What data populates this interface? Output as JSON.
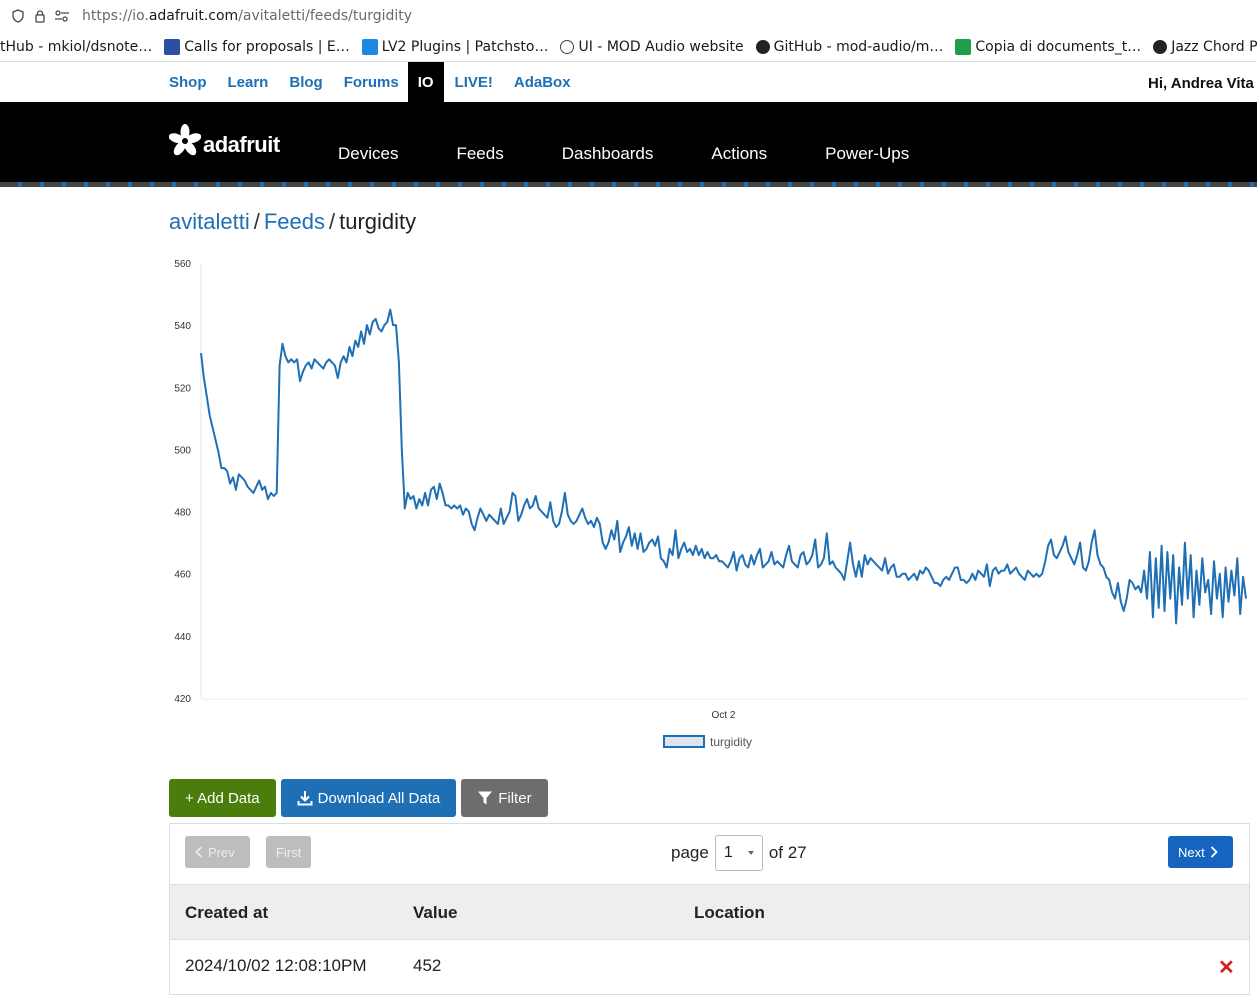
{
  "browser": {
    "url_prefix": "https://io.",
    "url_domain": "adafruit.com",
    "url_path": "/avitaletti/feeds/turgidity",
    "bookmarks": [
      {
        "label": "tHub - mkiol/dsnote…",
        "icon": "none"
      },
      {
        "label": "Calls for proposals | E…",
        "icon": "eu-icon"
      },
      {
        "label": "LV2 Plugins | Patchsto…",
        "icon": "patchstorage-icon"
      },
      {
        "label": "UI - MOD Audio website",
        "icon": "globe-icon"
      },
      {
        "label": "GitHub - mod-audio/m…",
        "icon": "github-icon"
      },
      {
        "label": "Copia di documents_t…",
        "icon": "sheets-icon"
      },
      {
        "label": "Jazz Chord Progre",
        "icon": "jazz-icon"
      }
    ]
  },
  "topnav": {
    "links": [
      "Shop",
      "Learn",
      "Blog",
      "Forums",
      "IO",
      "LIVE!",
      "AdaBox"
    ],
    "active": "IO",
    "greeting": "Hi, Andrea Vita"
  },
  "header": {
    "logo_text": "adafruit",
    "nav": [
      "Devices",
      "Feeds",
      "Dashboards",
      "Actions",
      "Power-Ups"
    ]
  },
  "breadcrumb": {
    "user": "avitaletti",
    "section": "Feeds",
    "current": "turgidity",
    "sep": "/"
  },
  "chart_data": {
    "type": "line",
    "title": "",
    "xlabel": "",
    "ylabel": "",
    "ylim": [
      420,
      560
    ],
    "yticks": [
      420,
      440,
      460,
      480,
      500,
      520,
      540,
      560
    ],
    "xticks": [
      {
        "label": "Oct 2",
        "frac": 0.5
      }
    ],
    "legend": {
      "label": "turgidity",
      "position": "bottom"
    },
    "grid": false,
    "colors": {
      "line": "#1f6fb5",
      "legend_fill": "#dde6f0"
    },
    "series": [
      {
        "name": "turgidity",
        "values": [
          531,
          523,
          517,
          511,
          507,
          503,
          499,
          494,
          494,
          493,
          489,
          491,
          487,
          492,
          491,
          490,
          488,
          487,
          486,
          488,
          490,
          487,
          488,
          484,
          486,
          485,
          486,
          527,
          534,
          530,
          528,
          529,
          528,
          529,
          522,
          525,
          527,
          528,
          526,
          529,
          528,
          527,
          526,
          528,
          529,
          528,
          527,
          523,
          528,
          530,
          528,
          533,
          530,
          535,
          533,
          538,
          534,
          540,
          537,
          541,
          542,
          539,
          538,
          540,
          541,
          545,
          540,
          540,
          528,
          500,
          481,
          486,
          484,
          485,
          481,
          484,
          482,
          486,
          482,
          487,
          488,
          484,
          489,
          486,
          482,
          482,
          481,
          482,
          481,
          482,
          479,
          481,
          480,
          476,
          474,
          478,
          481,
          479,
          477,
          479,
          478,
          477,
          476,
          481,
          476,
          478,
          480,
          486,
          485,
          477,
          479,
          482,
          484,
          481,
          482,
          485,
          481,
          480,
          479,
          478,
          483,
          477,
          475,
          476,
          480,
          486,
          479,
          477,
          476,
          477,
          479,
          481,
          478,
          476,
          477,
          475,
          478,
          476,
          470,
          468,
          470,
          474,
          471,
          477,
          467,
          470,
          472,
          475,
          469,
          473,
          468,
          473,
          467,
          468,
          470,
          471,
          469,
          472,
          465,
          464,
          462,
          468,
          466,
          474,
          465,
          468,
          470,
          467,
          468,
          466,
          469,
          466,
          468,
          465,
          467,
          465,
          465,
          466,
          464,
          464,
          463,
          462,
          464,
          467,
          461,
          465,
          466,
          463,
          462,
          466,
          463,
          466,
          468,
          462,
          463,
          464,
          467,
          463,
          464,
          463,
          462,
          466,
          469,
          464,
          463,
          462,
          466,
          467,
          463,
          464,
          466,
          471,
          462,
          463,
          465,
          473,
          463,
          464,
          462,
          461,
          460,
          458,
          464,
          470,
          463,
          459,
          464,
          459,
          466,
          463,
          465,
          464,
          463,
          462,
          461,
          465,
          460,
          462,
          463,
          459,
          459,
          460,
          460,
          458,
          459,
          460,
          458,
          461,
          460,
          462,
          461,
          459,
          457,
          457,
          456,
          458,
          459,
          458,
          460,
          462,
          462,
          458,
          458,
          457,
          458,
          460,
          458,
          461,
          460,
          459,
          463,
          456,
          461,
          462,
          460,
          461,
          461,
          463,
          460,
          461,
          462,
          460,
          459,
          458,
          461,
          460,
          459,
          460,
          459,
          460,
          464,
          469,
          471,
          466,
          465,
          467,
          469,
          472,
          467,
          465,
          463,
          466,
          470,
          462,
          461,
          464,
          470,
          474,
          466,
          463,
          462,
          459,
          458,
          454,
          452,
          457,
          451,
          448,
          452,
          458,
          457,
          455,
          456,
          454,
          461,
          452,
          467,
          446,
          465,
          449,
          469,
          448,
          467,
          452,
          466,
          444,
          462,
          450,
          470,
          452,
          466,
          446,
          461,
          450,
          465,
          454,
          458,
          447,
          464,
          452,
          460,
          446,
          462,
          451,
          461,
          453,
          465,
          447,
          459,
          452
        ]
      }
    ]
  },
  "buttons": {
    "add": "+ Add Data",
    "download": "Download All Data",
    "filter": "Filter"
  },
  "pager": {
    "prev": "Prev",
    "first": "First",
    "next": "Next",
    "page_label": "page",
    "current_page": "1",
    "of_label": "of 27"
  },
  "table": {
    "headers": [
      "Created at",
      "Value",
      "Location"
    ],
    "rows": [
      {
        "created_at": "2024/10/02 12:08:10PM",
        "value": "452",
        "location": ""
      }
    ],
    "delete_glyph": "✕"
  }
}
